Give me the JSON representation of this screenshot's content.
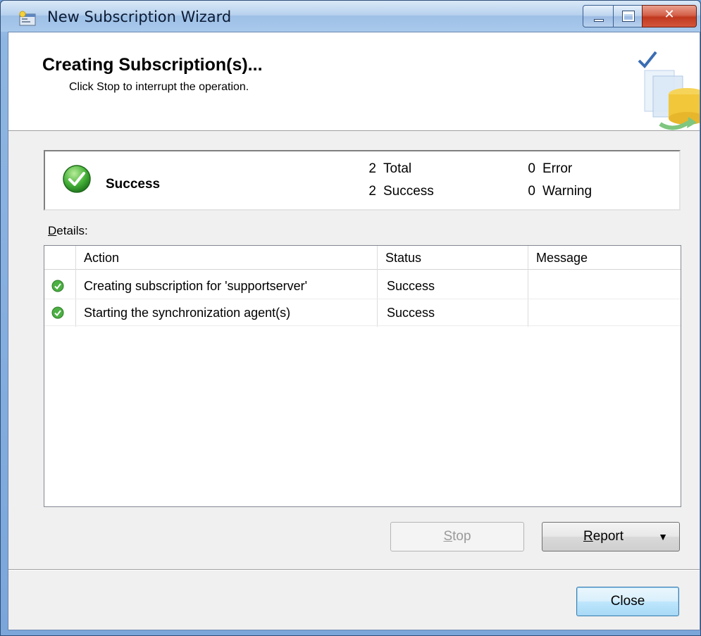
{
  "window": {
    "title": "New Subscription Wizard"
  },
  "header": {
    "title": "Creating Subscription(s)...",
    "subtitle": "Click Stop to interrupt the operation."
  },
  "summary": {
    "status": "Success",
    "total_count": "2",
    "total_label": "Total",
    "success_count": "2",
    "success_label": "Success",
    "error_count": "0",
    "error_label": "Error",
    "warning_count": "0",
    "warning_label": "Warning"
  },
  "details": {
    "label_first": "D",
    "label_rest": "etails:",
    "columns": [
      "Action",
      "Status",
      "Message"
    ],
    "rows": [
      {
        "action": "Creating subscription for 'supportserver'",
        "status": "Success",
        "message": ""
      },
      {
        "action": "Starting the synchronization agent(s)",
        "status": "Success",
        "message": ""
      }
    ]
  },
  "buttons": {
    "stop_first": "S",
    "stop_rest": "top",
    "report_first": "R",
    "report_rest": "eport",
    "close": "Close"
  },
  "colors": {
    "success_green": "#3aa23a",
    "title_bar": "#b8d2ee",
    "close_red": "#c0391f"
  }
}
